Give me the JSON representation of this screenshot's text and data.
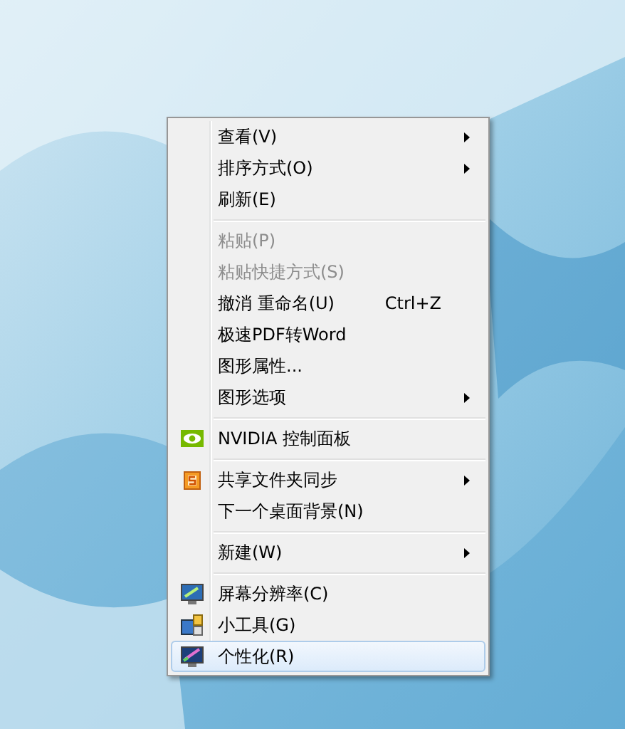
{
  "context_menu": {
    "items": [
      {
        "kind": "item",
        "label": "查看(V)",
        "submenu": true,
        "disabled": false,
        "selected": false
      },
      {
        "kind": "item",
        "label": "排序方式(O)",
        "submenu": true,
        "disabled": false,
        "selected": false
      },
      {
        "kind": "item",
        "label": "刷新(E)",
        "submenu": false,
        "disabled": false,
        "selected": false
      },
      {
        "kind": "separator"
      },
      {
        "kind": "item",
        "label": "粘贴(P)",
        "submenu": false,
        "disabled": true,
        "selected": false
      },
      {
        "kind": "item",
        "label": "粘贴快捷方式(S)",
        "submenu": false,
        "disabled": true,
        "selected": false
      },
      {
        "kind": "item",
        "label": "撤消 重命名(U)",
        "shortcut": "Ctrl+Z",
        "submenu": false,
        "disabled": false,
        "selected": false
      },
      {
        "kind": "item",
        "label": "极速PDF转Word",
        "submenu": false,
        "disabled": false,
        "selected": false
      },
      {
        "kind": "item",
        "label": "图形属性...",
        "submenu": false,
        "disabled": false,
        "selected": false
      },
      {
        "kind": "item",
        "label": "图形选项",
        "submenu": true,
        "disabled": false,
        "selected": false
      },
      {
        "kind": "separator"
      },
      {
        "kind": "item",
        "label": "NVIDIA 控制面板",
        "submenu": false,
        "disabled": false,
        "selected": false
      },
      {
        "kind": "separator"
      },
      {
        "kind": "item",
        "label": "共享文件夹同步",
        "submenu": true,
        "disabled": false,
        "selected": false
      },
      {
        "kind": "item",
        "label": "下一个桌面背景(N)",
        "submenu": false,
        "disabled": false,
        "selected": false
      },
      {
        "kind": "separator"
      },
      {
        "kind": "item",
        "label": "新建(W)",
        "submenu": true,
        "disabled": false,
        "selected": false
      },
      {
        "kind": "separator"
      },
      {
        "kind": "item",
        "label": "屏幕分辨率(C)",
        "submenu": false,
        "disabled": false,
        "selected": false
      },
      {
        "kind": "item",
        "label": "小工具(G)",
        "submenu": false,
        "disabled": false,
        "selected": false
      },
      {
        "kind": "item",
        "label": "个性化(R)",
        "submenu": false,
        "disabled": false,
        "selected": true
      }
    ]
  }
}
